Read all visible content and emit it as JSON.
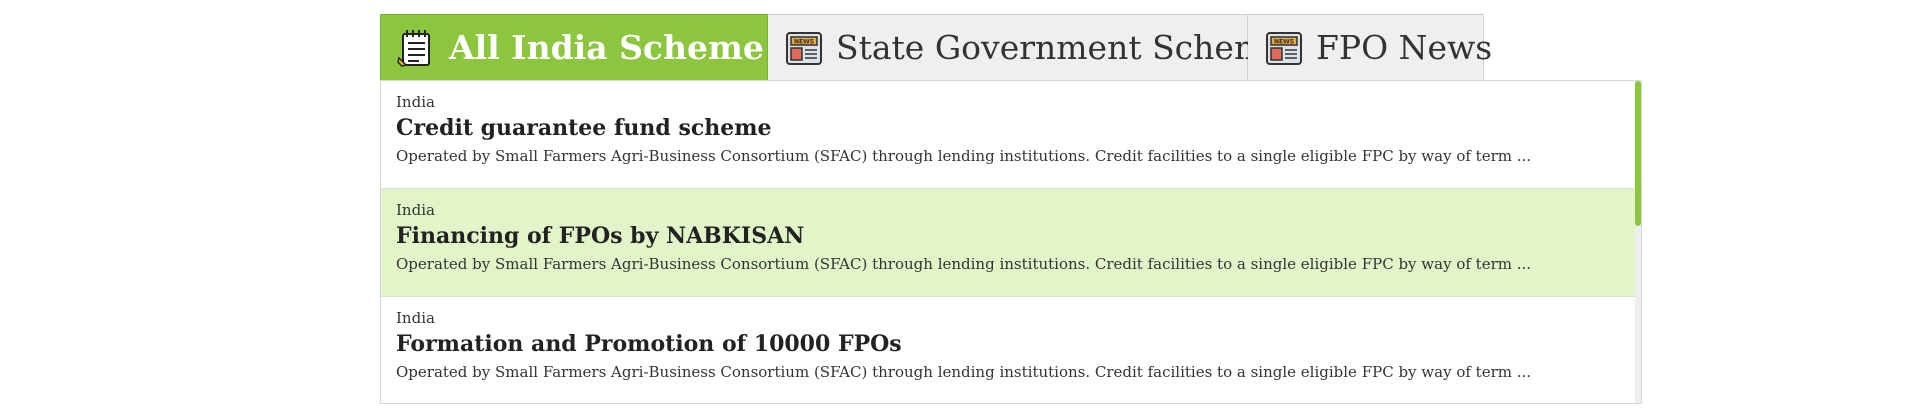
{
  "tabs": [
    {
      "label": "All India Scheme",
      "icon": "notepad-icon",
      "active": true
    },
    {
      "label": "State Government Scheme",
      "icon": "newspaper-icon",
      "active": false
    },
    {
      "label": "FPO News",
      "icon": "newspaper-icon",
      "active": false
    }
  ],
  "items": [
    {
      "region": "India",
      "title": "Credit guarantee fund scheme",
      "desc": "Operated by Small Farmers Agri-Business Consortium (SFAC) through lending institutions. Credit facilities to a single eligible FPC by way of term ..."
    },
    {
      "region": "India",
      "title": "Financing of FPOs by NABKISAN",
      "desc": "Operated by Small Farmers Agri-Business Consortium (SFAC) through lending institutions. Credit facilities to a single eligible FPC by way of term ..."
    },
    {
      "region": "India",
      "title": "Formation and Promotion of 10000 FPOs",
      "desc": "Operated by Small Farmers Agri-Business Consortium (SFAC) through lending institutions. Credit facilities to a single eligible FPC by way of term ..."
    }
  ],
  "colors": {
    "accent": "#8cc63f",
    "highlight_row": "#e2f5c9",
    "inactive_tab": "#efefef"
  }
}
